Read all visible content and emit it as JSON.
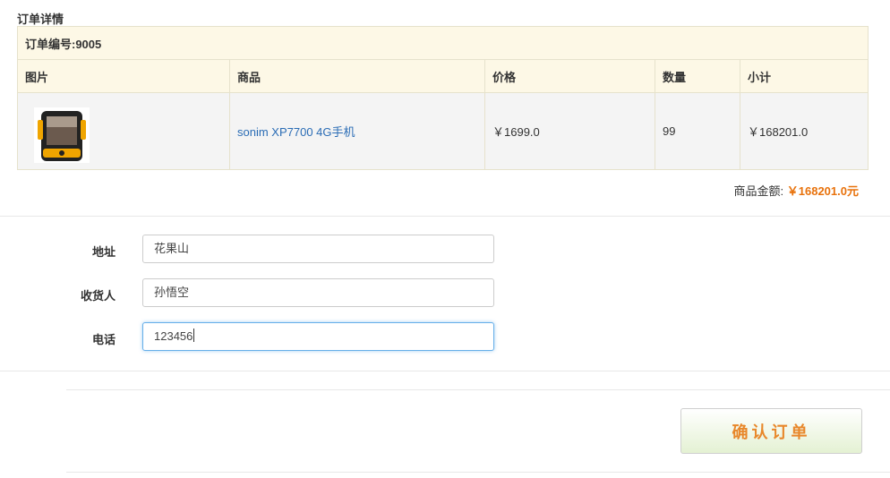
{
  "page": {
    "section_title": "订单详情"
  },
  "order": {
    "order_no_label": "订单编号:9005",
    "columns": [
      "图片",
      "商品",
      "价格",
      "数量",
      "小计"
    ],
    "items": [
      {
        "image_icon": "rugged-phone-image",
        "name": "sonim XP7700 4G手机",
        "price": "￥1699.0",
        "quantity": "99",
        "subtotal": "￥168201.0"
      }
    ],
    "total_label": "商品金额:",
    "total_value": "￥168201.0元"
  },
  "form": {
    "address": {
      "label": "地址",
      "value": "花果山"
    },
    "receiver": {
      "label": "收货人",
      "value": "孙悟空"
    },
    "phone": {
      "label": "电话",
      "value": "123456"
    }
  },
  "confirm_button": {
    "label": "确认订单"
  },
  "colors": {
    "accent": "#e8720c",
    "link": "#2a6cb5",
    "table_header_bg": "#fdf8e6",
    "button_gradient_end": "#e4f1d3"
  }
}
